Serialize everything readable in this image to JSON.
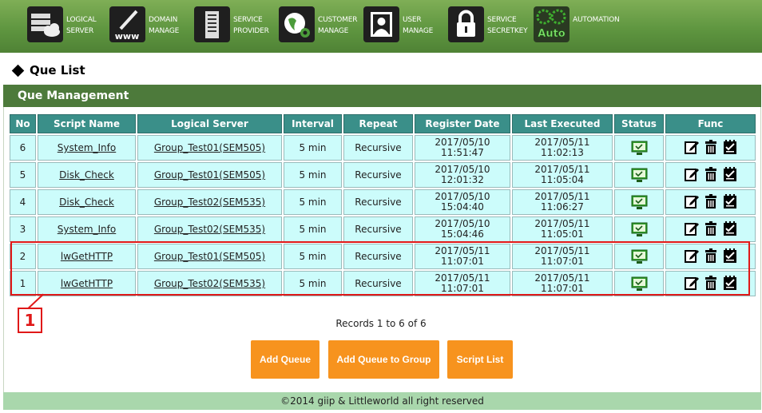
{
  "nav": [
    {
      "key": "logical_server",
      "label": "LOGICAL\nSERVER",
      "icon": "server-cloud-icon"
    },
    {
      "key": "domain_manage",
      "label": "DOMAIN\nMANAGE",
      "icon": "www-pen-icon"
    },
    {
      "key": "service_provider",
      "label": "SERVICE\nPROVIDER",
      "icon": "building-icon"
    },
    {
      "key": "customer_manage",
      "label": "CUSTOMER\nMANAGE",
      "icon": "globe-gear-icon"
    },
    {
      "key": "user_manage",
      "label": "USER\nMANAGE",
      "icon": "user-portrait-icon"
    },
    {
      "key": "service_secretkey",
      "label": "SERVICE\nSECRETKEY",
      "icon": "padlock-icon"
    },
    {
      "key": "automation",
      "label": "AUTOMATION",
      "icon": "auto-gears-icon",
      "icon_text": "Auto"
    }
  ],
  "page": {
    "title": "Que List",
    "section": "Que Management"
  },
  "table": {
    "headers": [
      "No",
      "Script Name",
      "Logical Server",
      "Interval",
      "Repeat",
      "Register Date",
      "Last Executed",
      "Status",
      "Func"
    ],
    "rows": [
      {
        "no": "6",
        "script": "System_Info",
        "server": "Group_Test01(SEM505)",
        "interval": "5 min",
        "repeat": "Recursive",
        "reg_date": "2017/05/10",
        "reg_time": "11:51:47",
        "last_date": "2017/05/11",
        "last_time": "11:02:13"
      },
      {
        "no": "5",
        "script": "Disk_Check",
        "server": "Group_Test01(SEM505)",
        "interval": "5 min",
        "repeat": "Recursive",
        "reg_date": "2017/05/10",
        "reg_time": "12:01:32",
        "last_date": "2017/05/11",
        "last_time": "11:05:04"
      },
      {
        "no": "4",
        "script": "Disk_Check",
        "server": "Group_Test02(SEM535)",
        "interval": "5 min",
        "repeat": "Recursive",
        "reg_date": "2017/05/10",
        "reg_time": "15:04:40",
        "last_date": "2017/05/11",
        "last_time": "11:06:27"
      },
      {
        "no": "3",
        "script": "System_Info",
        "server": "Group_Test02(SEM535)",
        "interval": "5 min",
        "repeat": "Recursive",
        "reg_date": "2017/05/10",
        "reg_time": "15:04:46",
        "last_date": "2017/05/11",
        "last_time": "11:05:01"
      },
      {
        "no": "2",
        "script": "lwGetHTTP",
        "server": "Group_Test01(SEM505)",
        "interval": "5 min",
        "repeat": "Recursive",
        "reg_date": "2017/05/11",
        "reg_time": "11:07:01",
        "last_date": "2017/05/11",
        "last_time": "11:07:01"
      },
      {
        "no": "1",
        "script": "lwGetHTTP",
        "server": "Group_Test02(SEM535)",
        "interval": "5 min",
        "repeat": "Recursive",
        "reg_date": "2017/05/11",
        "reg_time": "11:07:01",
        "last_date": "2017/05/11",
        "last_time": "11:07:01"
      }
    ]
  },
  "callout": {
    "label": "1"
  },
  "records_text": "Records 1 to 6 of 6",
  "buttons": {
    "add_queue": "Add Queue",
    "add_queue_group": "Add Queue to Group",
    "script_list": "Script List"
  },
  "footer": "©2014 giip & Littleworld all right reserved",
  "colors": {
    "nav_green": "#5f9640",
    "section_green": "#4d7a3b",
    "header_teal": "#3a8f89",
    "cell_cyan": "#ccfcfb",
    "button_orange": "#f7931e",
    "footer_green": "#a9d7ac",
    "callout_red": "#e01818"
  }
}
